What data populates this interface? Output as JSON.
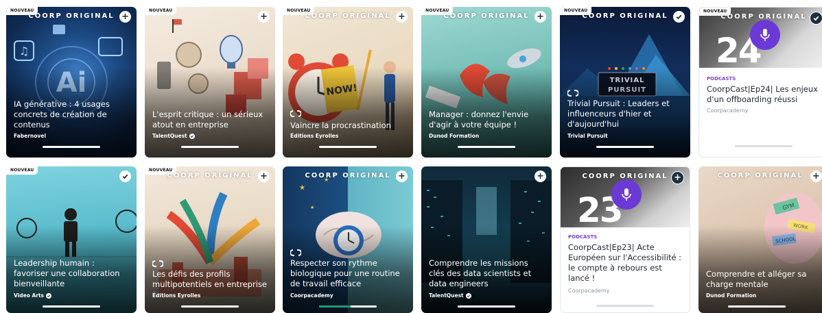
{
  "labels": {
    "new": "NOUVEAU",
    "original": "COORP ORIGINAL",
    "add": "+",
    "podcasts": "PODCASTS"
  },
  "colors": {
    "progress_fill": "#1f9a73",
    "podcast_category": "#7b3fd9",
    "mic_purple": "#6b3ad6"
  },
  "row1": [
    {
      "title": "IA générative : 4 usages concrets de création de contenus",
      "author": "Fabernovel",
      "new": true,
      "original": true,
      "action": "plus"
    },
    {
      "title": "L'esprit critique : un sérieux atout en entreprise",
      "author": "TalentQuest",
      "verified": true,
      "new": true,
      "original": false,
      "action": "plus"
    },
    {
      "title": "Vaincre la procrastination",
      "author": "Éditions Eyrolles",
      "new": true,
      "original": true,
      "action": "plus",
      "loop": true
    },
    {
      "title": "Manager : donnez l'envie d'agir à votre équipe !",
      "author": "Dunod Formation",
      "new": true,
      "original": true,
      "action": "plus"
    },
    {
      "title": "Trivial Pursuit : Leaders et influenceurs d'hier et d'aujourd'hui",
      "author": "Trivial Pursuit",
      "new": true,
      "original": true,
      "action": "check",
      "loop": true
    },
    {
      "title": "CoorpCast|Ep24| Les enjeux d'un offboarding réussi",
      "author": "Coorpacademy",
      "new": true,
      "original": true,
      "action": "check",
      "podcast": true,
      "episode": "24"
    }
  ],
  "row2": [
    {
      "title": "Leadership humain : favoriser une collaboration bienveillante",
      "author": "Video Arts",
      "verified": true,
      "new": true,
      "original": false,
      "action": "check"
    },
    {
      "title": "Les défis des profils multipotentiels en entreprise",
      "author": "Éditions Eyrolles",
      "new": true,
      "original": true,
      "action": "plus",
      "loop": true
    },
    {
      "title": "Respecter son rythme biologique pour une routine de travail efficace",
      "author": "Coorpacademy",
      "new": false,
      "original": true,
      "action": "plus",
      "loop": true,
      "progress": 0.55
    },
    {
      "title": "Comprendre les missions clés des data scientists et data engineers",
      "author": "TalentQuest",
      "verified": true,
      "new": false,
      "original": false,
      "action": "plus"
    },
    {
      "title": "CoorpCast|Ep23| Acte Européen sur l'Accessibilité : le compte à rebours est lancé !",
      "author": "Coorpacademy",
      "new": false,
      "original": true,
      "action": "plus",
      "podcast": true,
      "episode": "23"
    },
    {
      "title": "Comprendre et alléger sa charge mentale",
      "author": "Dunod Formation",
      "new": false,
      "original": true,
      "action": "plus"
    }
  ]
}
